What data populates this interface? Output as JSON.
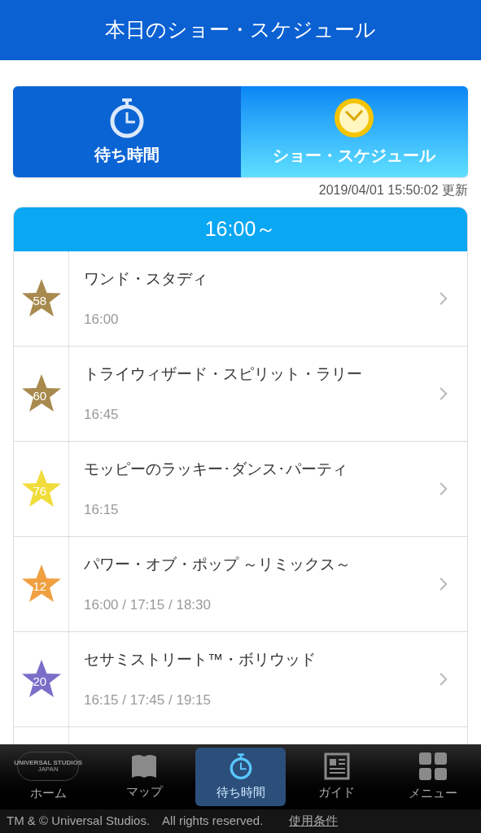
{
  "header": {
    "title": "本日のショー・スケジュール"
  },
  "tabs": [
    {
      "label": "待ち時間",
      "kind": "stopwatch",
      "selected": false
    },
    {
      "label": "ショー・スケジュール",
      "kind": "clock",
      "selected": true
    }
  ],
  "updated": "2019/04/01 15:50:02 更新",
  "section": {
    "title": "16:00～"
  },
  "shows": [
    {
      "badge": "58",
      "color": "#a88a4e",
      "name": "ワンド・スタディ",
      "times": "16:00"
    },
    {
      "badge": "60",
      "color": "#a88a4e",
      "name": "トライウィザード・スピリット・ラリー",
      "times": "16:45"
    },
    {
      "badge": "76",
      "color": "#f0dc3a",
      "name": "モッピーのラッキー･ダンス･パーティ",
      "times": "16:15"
    },
    {
      "badge": "12",
      "color": "#f0a040",
      "name": "パワー・オブ・ポップ ～リミックス～",
      "times": "16:00 / 17:15 / 18:30"
    },
    {
      "badge": "20",
      "color": "#7a6fc8",
      "name": "セサミストリート™・ボリウッド",
      "times": "16:15 / 17:45 / 19:15"
    }
  ],
  "nav": [
    {
      "kind": "logo",
      "label": "ホーム",
      "logo_text": "UNIVERSAL STUDIOS",
      "logo_subtext": "JAPAN",
      "selected": false
    },
    {
      "kind": "map",
      "label": "マップ",
      "selected": false
    },
    {
      "kind": "stopwatch",
      "label": "待ち時間",
      "selected": true
    },
    {
      "kind": "guide",
      "label": "ガイド",
      "selected": false
    },
    {
      "kind": "menu",
      "label": "メニュー",
      "selected": false
    }
  ],
  "footer": {
    "copyright": "TM & © Universal Studios.　All rights reserved.",
    "link": "使用条件"
  }
}
